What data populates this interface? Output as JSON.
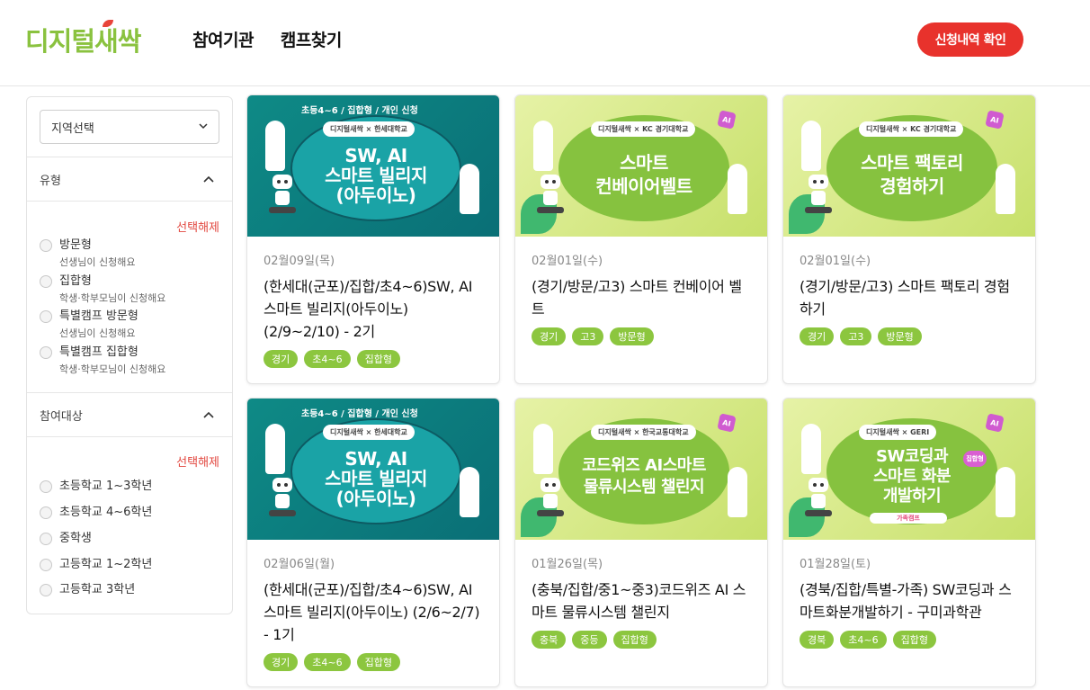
{
  "header": {
    "logo_part1": "디지털",
    "logo_part2": "새싹",
    "nav": [
      "참여기관",
      "캠프찾기"
    ],
    "apply_button": "신청내역 확인"
  },
  "sidebar": {
    "region_select": "지역선택",
    "type_section": {
      "title": "유형",
      "clear": "선택해제",
      "options": [
        {
          "label": "방문형",
          "sub": "선생님이 신청해요"
        },
        {
          "label": "집합형",
          "sub": "학생·학부모님이 신청해요"
        },
        {
          "label": "특별캠프 방문형",
          "sub": "선생님이 신청해요"
        },
        {
          "label": "특별캠프 집합형",
          "sub": "학생·학부모님이 신청해요"
        }
      ]
    },
    "target_section": {
      "title": "참여대상",
      "clear": "선택해제",
      "options": [
        "초등학교 1~3학년",
        "초등학교 4~6학년",
        "중학생",
        "고등학교 1~2학년",
        "고등학교 3학년"
      ]
    }
  },
  "cards": [
    {
      "thumb": {
        "theme": "teal",
        "topline": "초등4~6 / 집합형 / 개인 신청",
        "brand": "디지털새싹 × 한세대학교",
        "lines": [
          "SW, AI",
          "스마트 빌리지",
          "(아두이노)"
        ]
      },
      "date": "02월09일(목)",
      "title": "(한세대(군포)/집합/초4~6)SW, AI 스마트 빌리지(아두이노) (2/9~2/10) - 2기",
      "tags": [
        "경기",
        "초4~6",
        "집합형"
      ]
    },
    {
      "thumb": {
        "theme": "lime",
        "brand": "디지털새싹 × KC 경기대학교",
        "lines": [
          "스마트",
          "컨베이어벨트"
        ]
      },
      "date": "02월01일(수)",
      "title": "(경기/방문/고3) 스마트 컨베이어 벨트",
      "tags": [
        "경기",
        "고3",
        "방문형"
      ]
    },
    {
      "thumb": {
        "theme": "lime",
        "brand": "디지털새싹 × KC 경기대학교",
        "lines": [
          "스마트 팩토리",
          "경험하기"
        ]
      },
      "date": "02월01일(수)",
      "title": "(경기/방문/고3) 스마트 팩토리 경험하기",
      "tags": [
        "경기",
        "고3",
        "방문형"
      ]
    },
    {
      "thumb": {
        "theme": "teal",
        "topline": "초등4~6 / 집합형 / 개인 신청",
        "brand": "디지털새싹 × 한세대학교",
        "lines": [
          "SW, AI",
          "스마트 빌리지",
          "(아두이노)"
        ]
      },
      "date": "02월06일(월)",
      "title": "(한세대(군포)/집합/초4~6)SW, AI 스마트 빌리지(아두이노) (2/6~2/7) - 1기",
      "tags": [
        "경기",
        "초4~6",
        "집합형"
      ]
    },
    {
      "thumb": {
        "theme": "lime",
        "brand": "디지털새싹 × 한국교통대학교",
        "lines": [
          "코드위즈 AI스마트",
          "물류시스템 챌린지"
        ]
      },
      "date": "01월26일(목)",
      "title": "(충북/집합/중1~중3)코드위즈 AI 스마트 물류시스템 챌린지",
      "tags": [
        "충북",
        "중등",
        "집합형"
      ]
    },
    {
      "thumb": {
        "theme": "lime",
        "brand": "디지털새싹 × GERI",
        "lines": [
          "SW코딩과",
          "스마트 화분",
          "개발하기"
        ],
        "badge": "집합형",
        "subpill": "가족캠프"
      },
      "date": "01월28일(토)",
      "title": "(경북/집합/특별-가족) SW코딩과 스마트화분개발하기 - 구미과학관",
      "tags": [
        "경북",
        "초4~6",
        "집합형"
      ]
    }
  ]
}
